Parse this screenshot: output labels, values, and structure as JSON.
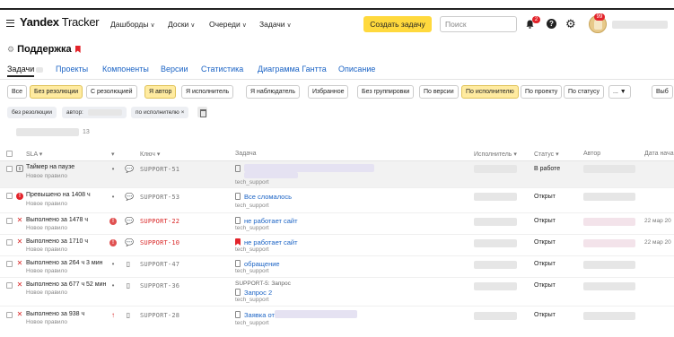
{
  "header": {
    "logo_bold": "Yandex",
    "logo_rest": " Tracker",
    "nav": [
      {
        "label": "Дашборды"
      },
      {
        "label": "Доски"
      },
      {
        "label": "Очереди"
      },
      {
        "label": "Задачи"
      }
    ],
    "create_label": "Создать задачу",
    "search_placeholder": "Поиск",
    "notifications_count": "2",
    "avatar_badge": "99",
    "help_glyph": "?"
  },
  "queue": {
    "title": "Поддержка"
  },
  "tabs": [
    {
      "label": "Задачи",
      "active": true
    },
    {
      "label": "Проекты"
    },
    {
      "label": "Компоненты"
    },
    {
      "label": "Версии"
    },
    {
      "label": "Статистика"
    },
    {
      "label": "Диаграмма Гантта"
    },
    {
      "label": "Описание"
    }
  ],
  "filters": [
    {
      "label": "Все"
    },
    {
      "label": "Без резолюции",
      "on": true
    },
    {
      "label": "С резолюцией"
    },
    {
      "label": "Я автор",
      "on": true
    },
    {
      "label": "Я исполнитель"
    },
    {
      "label": "Я наблюдатель"
    },
    {
      "label": "Избранное"
    },
    {
      "label": "Без группировки"
    },
    {
      "label": "По версии"
    },
    {
      "label": "По исполнителю",
      "on": true
    },
    {
      "label": "По проекту"
    },
    {
      "label": "По статусу"
    },
    {
      "label": "... ▼"
    },
    {
      "label": "Выб"
    }
  ],
  "chips": [
    {
      "label": "без резолюции"
    },
    {
      "label": "автор:"
    },
    {
      "label": "по исполнителю ×"
    }
  ],
  "group_count": "13",
  "columns": {
    "sla": "SLA ▾",
    "prio": "▾",
    "key": "Ключ ▾",
    "task": "Задача",
    "assignee": "Исполнитель ▾",
    "status": "Статус ▾",
    "author": "Автор",
    "created": "Дата нача"
  },
  "rows": [
    {
      "sla": "Таймер на паузе",
      "sla_sub": "Новое правило",
      "key": "SUPPORT-51",
      "title": "",
      "sub": "tech_support",
      "status": "В работе",
      "date": ""
    },
    {
      "sla": "Превышено на 1408 ч",
      "sla_sub": "Новое правило",
      "key": "SUPPORT-53",
      "title": "Все сломалось",
      "sub": "tech_support",
      "status": "Открыт",
      "date": ""
    },
    {
      "sla": "Выполнено за 1478 ч",
      "sla_sub": "Новое правило",
      "key": "SUPPORT-22",
      "title": "не работает сайт",
      "sub": "tech_support",
      "status": "Открыт",
      "date": "22 мар 20"
    },
    {
      "sla": "Выполнено за 1710 ч",
      "sla_sub": "Новое правило",
      "key": "SUPPORT-10",
      "title": "не работает сайт",
      "sub": "tech_support",
      "status": "Открыт",
      "date": "22 мар 20"
    },
    {
      "sla": "Выполнено за 264 ч 3 мин",
      "sla_sub": "Новое правило",
      "key": "SUPPORT-47",
      "title": "обращение",
      "sub": "tech_support",
      "status": "Открыт",
      "date": ""
    },
    {
      "sla": "Выполнено за 677 ч 52 мин",
      "sla_sub": "Новое правило",
      "key": "SUPPORT-36",
      "pre": "SUPPORT-5: Запрос",
      "title": "Запрос 2",
      "sub": "tech_support",
      "status": "Открыт",
      "date": ""
    },
    {
      "sla": "Выполнено за 938 ч",
      "sla_sub": "Новое правило",
      "key": "SUPPORT-28",
      "title": "Заявка от",
      "sub": "tech_support",
      "status": "Открыт",
      "date": ""
    }
  ]
}
